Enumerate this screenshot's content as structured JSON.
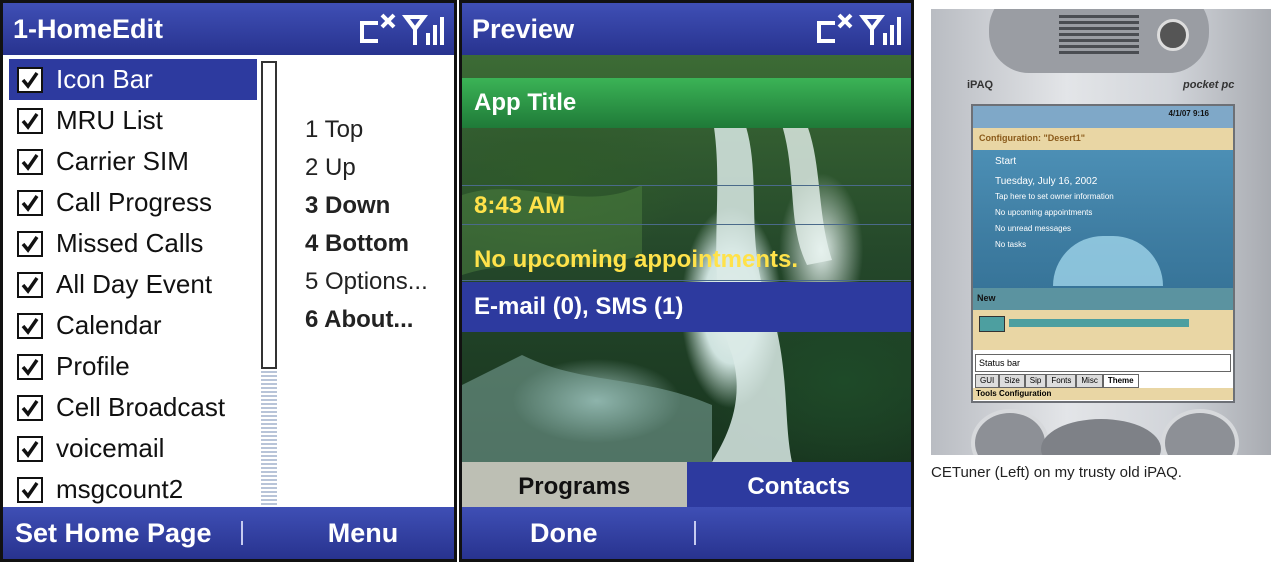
{
  "homeedit": {
    "title": "1-HomeEdit",
    "items": [
      {
        "label": "Icon Bar",
        "checked": true,
        "selected": true
      },
      {
        "label": "MRU List",
        "checked": true
      },
      {
        "label": "Carrier SIM",
        "checked": true
      },
      {
        "label": "Call Progress",
        "checked": true
      },
      {
        "label": "Missed Calls",
        "checked": true
      },
      {
        "label": "All Day Event",
        "checked": true
      },
      {
        "label": "Calendar",
        "checked": true
      },
      {
        "label": "Profile",
        "checked": true
      },
      {
        "label": "Cell Broadcast",
        "checked": true
      },
      {
        "label": "voicemail",
        "checked": true
      },
      {
        "label": "msgcount2",
        "checked": true
      }
    ],
    "menu": [
      {
        "label": "1 Top",
        "bold": false
      },
      {
        "label": "2 Up",
        "bold": false
      },
      {
        "label": "3 Down",
        "bold": true
      },
      {
        "label": "4 Bottom",
        "bold": true
      },
      {
        "label": "5 Options...",
        "bold": false
      },
      {
        "label": "6 About...",
        "bold": true
      }
    ],
    "softkeys": {
      "left": "Set Home Page",
      "right": "Menu"
    }
  },
  "preview": {
    "title": "Preview",
    "app_title": "App Title",
    "time": "8:43 AM",
    "appointments": "No upcoming appointments.",
    "messages": "E-mail (0), SMS (1)",
    "tabs": [
      "Programs",
      "Contacts"
    ],
    "softkeys": {
      "left": "Done"
    }
  },
  "device_photo": {
    "caption": "CETuner (Left) on my trusty old iPAQ.",
    "brand": "iPAQ",
    "os_brand": "pocket pc",
    "clock": "4/1/07 9:16",
    "banner": "Configuration: \"Desert1\"",
    "start": "Start",
    "today_date": "Tuesday, July 16, 2002",
    "owner": "Tap here to set owner information",
    "appointments": "No upcoming appointments",
    "messages": "No unread messages",
    "tasks": "No tasks",
    "new_label": "New",
    "status_field": "Status bar",
    "tabs": [
      "GUI",
      "Size",
      "Sip",
      "Fonts",
      "Misc",
      "Theme"
    ],
    "footer": "Tools Configuration"
  },
  "colors": {
    "title_bar": "#2d3a9f",
    "highlight": "#2d3a9f",
    "preview_yellow": "#ffe24a",
    "tab_active": "#bdbfb4"
  }
}
